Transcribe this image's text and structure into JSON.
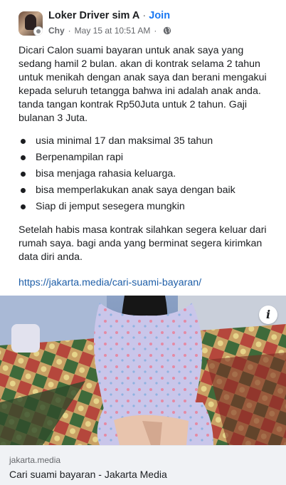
{
  "header": {
    "group_name": "Loker Driver sim A",
    "separator": "·",
    "join_label": "Join",
    "author": "Chy",
    "date": "May 15 at 10:51 AM",
    "privacy_icon": "globe-icon"
  },
  "post": {
    "paragraph1": "Dicari Calon suami bayaran untuk anak saya yang sedang hamil 2 bulan. akan di kontrak selama 2 tahun untuk menikah dengan anak saya dan berani mengakui kepada seluruh tetangga bahwa ini adalah anak anda. tanda tangan kontrak Rp50Juta untuk 2 tahun. Gaji bulanan 3 Juta.",
    "bullets": [
      "usia minimal 17 dan maksimal 35 tahun",
      "Berpenampilan rapi",
      "bisa menjaga rahasia keluarga.",
      "bisa memperlakukan anak saya dengan baik",
      "Siap di jemput sesegera mungkin"
    ],
    "paragraph2": "Setelah habis masa kontrak silahkan segera keluar dari rumah saya. bagi anda yang berminat segera kirimkan data diri anda.",
    "link": "https://jakarta.media/cari-suami-bayaran/"
  },
  "image": {
    "info_label": "i"
  },
  "link_preview": {
    "domain": "jakarta.media",
    "title": "Cari suami bayaran - Jakarta Media"
  }
}
